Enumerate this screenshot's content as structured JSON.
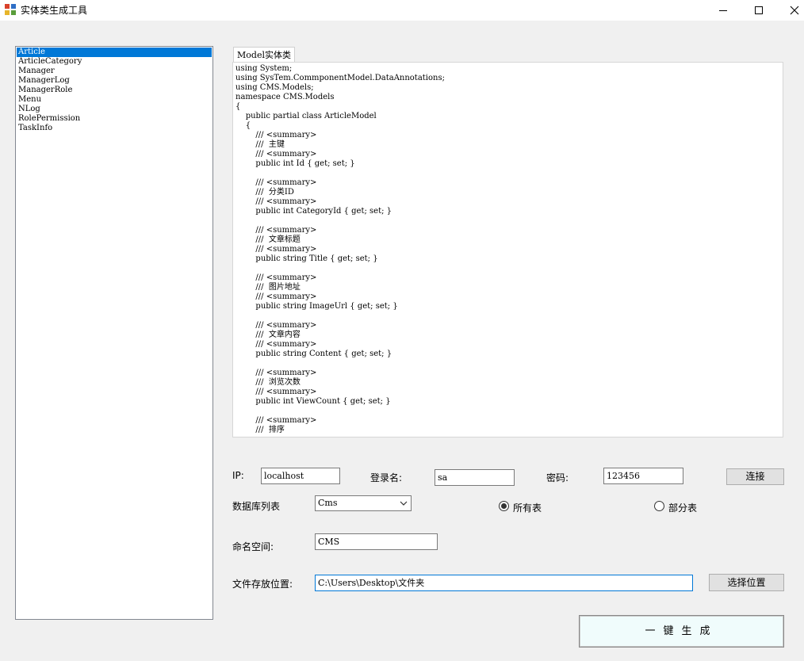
{
  "window": {
    "title": "实体类生成工具"
  },
  "table_list": {
    "items": [
      "Article",
      "ArticleCategory",
      "Manager",
      "ManagerLog",
      "ManagerRole",
      "Menu",
      "NLog",
      "RolePermission",
      "TaskInfo"
    ],
    "selected_index": 0
  },
  "tab": {
    "label": "Model实体类"
  },
  "code": {
    "lines": [
      "using System;",
      "using SysTem.CommponentModel.DataAnnotations;",
      "using CMS.Models;",
      "namespace CMS.Models",
      "{",
      "    public partial class ArticleModel",
      "    {",
      "        /// <summary>",
      "        ///  主键",
      "        /// <summary>",
      "        public int Id { get; set; }",
      "",
      "        /// <summary>",
      "        ///  分类ID",
      "        /// <summary>",
      "        public int CategoryId { get; set; }",
      "",
      "        /// <summary>",
      "        ///  文章标题",
      "        /// <summary>",
      "        public string Title { get; set; }",
      "",
      "        /// <summary>",
      "        ///  图片地址",
      "        /// <summary>",
      "        public string ImageUrl { get; set; }",
      "",
      "        /// <summary>",
      "        ///  文章内容",
      "        /// <summary>",
      "        public string Content { get; set; }",
      "",
      "        /// <summary>",
      "        ///  浏览次数",
      "        /// <summary>",
      "        public int ViewCount { get; set; }",
      "",
      "        /// <summary>",
      "        ///  排序"
    ]
  },
  "connection": {
    "ip_label": "IP:",
    "ip_value": "localhost",
    "login_label": "登录名:",
    "login_value": "sa",
    "password_label": "密码:",
    "password_value": "123456",
    "connect_button": "连接"
  },
  "database": {
    "label": "数据库列表",
    "selected": "Cms",
    "radio_all": "所有表",
    "radio_partial": "部分表",
    "all_selected": true
  },
  "namespace_field": {
    "label": "命名空间:",
    "value": "CMS"
  },
  "file_location": {
    "label": "文件存放位置:",
    "value": "C:\\Users\\Desktop\\文件夹",
    "choose_button": "选择位置"
  },
  "generate_button": "一键生成",
  "colors": {
    "selection": "#0078d7",
    "background": "#f0f0f0",
    "generate_bg": "#f0fcfc"
  }
}
